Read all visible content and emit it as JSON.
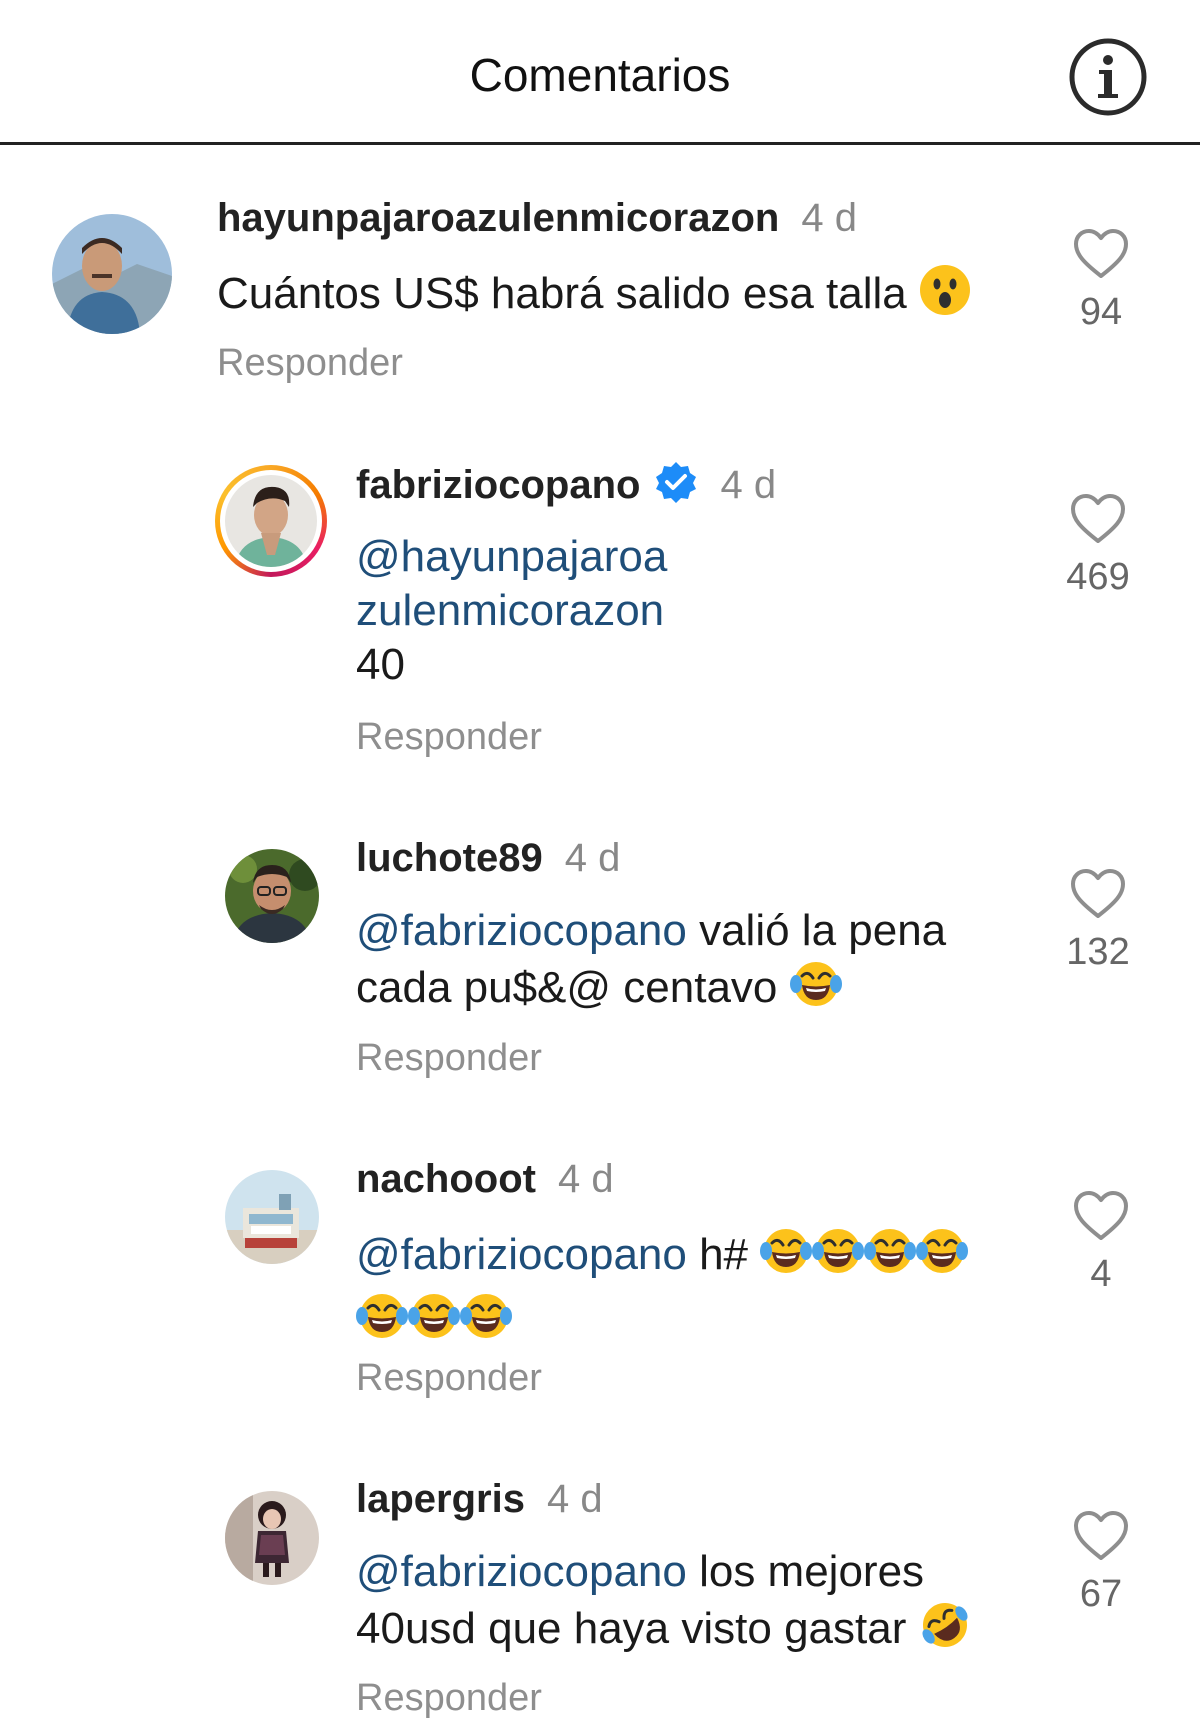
{
  "header": {
    "title": "Comentarios",
    "info_icon": "info-icon"
  },
  "comments": [
    {
      "username": "hayunpajaroazulenmicorazon",
      "time": "4 d",
      "text": "Cuántos US$ habrá salido esa talla",
      "emoji": "astonished-face",
      "reply_label": "Responder",
      "likes": "94"
    },
    {
      "username": "fabriziocopano",
      "verified": true,
      "time": "4 d",
      "mention_line1": "@hayunpajaroa",
      "mention_line2": "zulenmicorazon",
      "text": "40",
      "reply_label": "Responder",
      "likes": "469"
    },
    {
      "username": "luchote89",
      "time": "4 d",
      "mention": "@fabriziocopano",
      "text_line1": " valió la pena",
      "text_line2": "cada pu$&@ centavo",
      "emoji": "face-with-tears-of-joy",
      "reply_label": "Responder",
      "likes": "132"
    },
    {
      "username": "nachooot",
      "time": "4 d",
      "mention": "@fabriziocopano",
      "text": " h#",
      "emoji": "face-with-tears-of-joy",
      "emoji_count": 7,
      "reply_label": "Responder",
      "likes": "4"
    },
    {
      "username": "lapergris",
      "time": "4 d",
      "mention": "@fabriziocopano",
      "text_line1": " los mejores",
      "text_line2": "40usd que haya visto gastar",
      "emoji": "rolling-on-the-floor-laughing",
      "reply_label": "Responder",
      "likes": "67"
    }
  ],
  "colors": {
    "mention": "#1f4e79",
    "verified": "#1d8cf8",
    "muted": "#8e8e8e"
  }
}
